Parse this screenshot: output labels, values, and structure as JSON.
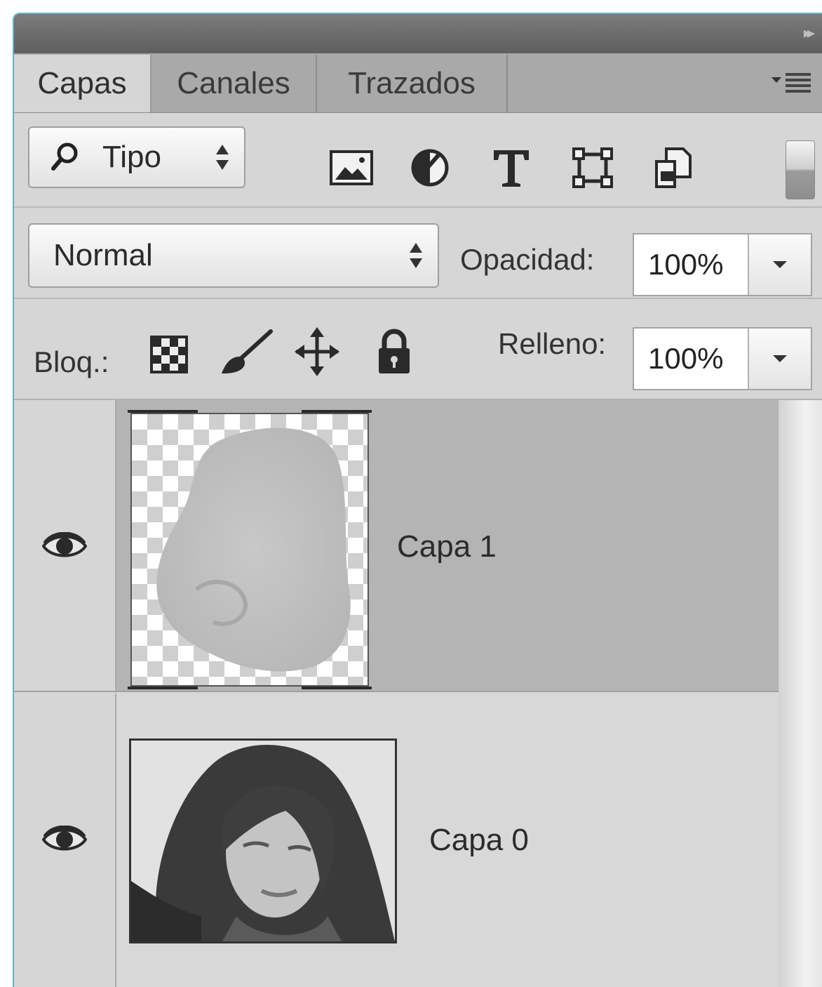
{
  "tabs": [
    {
      "label": "Capas",
      "active": true
    },
    {
      "label": "Canales",
      "active": false
    },
    {
      "label": "Trazados",
      "active": false
    }
  ],
  "filter": {
    "kind_value": "Tipo",
    "icons": [
      "image-filter-icon",
      "adjustment-filter-icon",
      "type-filter-icon",
      "shape-filter-icon",
      "smart-object-filter-icon"
    ]
  },
  "blend": {
    "mode": "Normal",
    "opacity_label": "Opacidad:",
    "opacity_value": "100%"
  },
  "lock": {
    "label": "Bloq.:",
    "fill_label": "Relleno:",
    "fill_value": "100%"
  },
  "layers": [
    {
      "name": "Capa 1",
      "visible": true,
      "selected": true,
      "thumbnail": "nose-on-transparent"
    },
    {
      "name": "Capa 0",
      "visible": true,
      "selected": false,
      "thumbnail": "woman-portrait"
    }
  ],
  "colors": {
    "panel_bg": "#d6d6d6",
    "selected_layer": "#b4b4b4",
    "accent_border": "#58b8cf"
  }
}
